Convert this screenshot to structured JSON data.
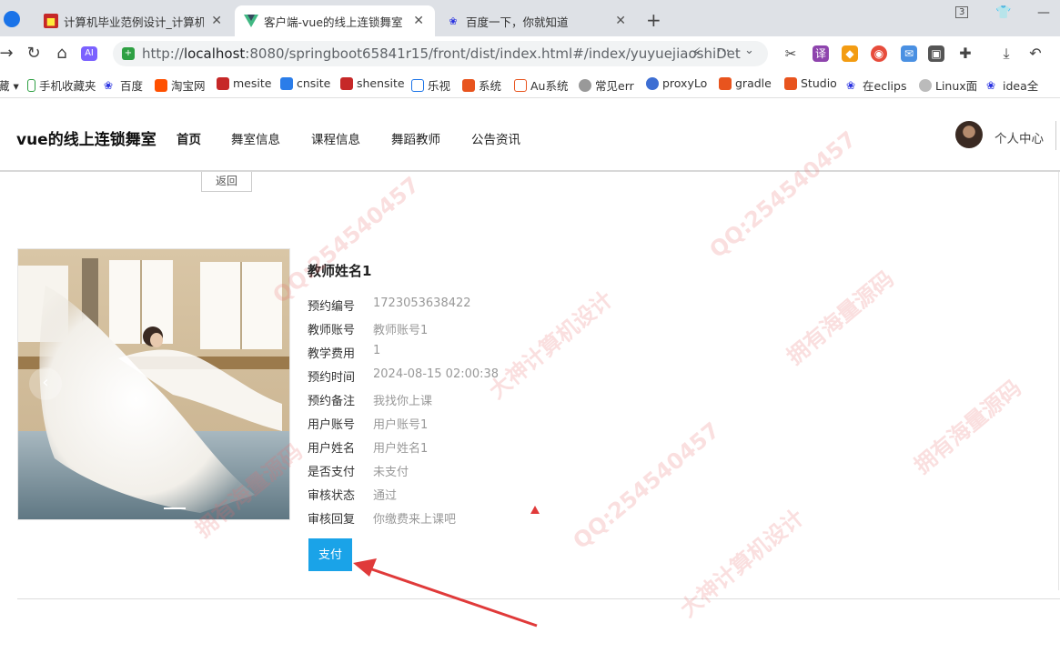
{
  "browser": {
    "tabs": [
      {
        "title": "计算机毕业范例设计_计算机项",
        "active": false
      },
      {
        "title": "客户端-vue的线上连锁舞室",
        "active": true
      },
      {
        "title": "百度一下，你就知道",
        "active": false
      }
    ],
    "tab_count_badge": "3",
    "url": {
      "scheme": "http://",
      "host": "localhost",
      "rest": ":8080/springboot65841r15/front/dist/index.html#/index/yuyuejiaoshiDet"
    },
    "bookmarks": [
      "手机收藏夹",
      "百度",
      "淘宝网",
      "mesite",
      "cnsite",
      "shensite",
      "乐视",
      "系统",
      "Au系统",
      "常见err",
      "proxyLo",
      "gradle",
      "Studio",
      "在eclips",
      "Linux面",
      "idea全"
    ]
  },
  "site": {
    "brand": "vue的线上连锁舞室",
    "menu": [
      "首页",
      "舞室信息",
      "课程信息",
      "舞蹈教师",
      "公告资讯"
    ],
    "user_center": "个人中心"
  },
  "back_button": "返回",
  "teacher_name": "教师姓名1",
  "details": [
    {
      "label": "预约编号",
      "value": "1723053638422"
    },
    {
      "label": "教师账号",
      "value": "教师账号1"
    },
    {
      "label": "教学费用",
      "value": "1"
    },
    {
      "label": "预约时间",
      "value": "2024-08-15 02:00:38"
    },
    {
      "label": "预约备注",
      "value": "我找你上课"
    },
    {
      "label": "用户账号",
      "value": "用户账号1"
    },
    {
      "label": "用户姓名",
      "value": "用户姓名1"
    },
    {
      "label": "是否支付",
      "value": "未支付"
    },
    {
      "label": "审核状态",
      "value": "通过"
    },
    {
      "label": "审核回复",
      "value": "你缴费来上课吧"
    }
  ],
  "pay_button": "支付",
  "watermarks": [
    "QQ:254540457",
    "拥有海量源码",
    "大神计算机设计"
  ],
  "colors": {
    "accent": "#1aa3e8",
    "annotation": "#e03a3a"
  }
}
